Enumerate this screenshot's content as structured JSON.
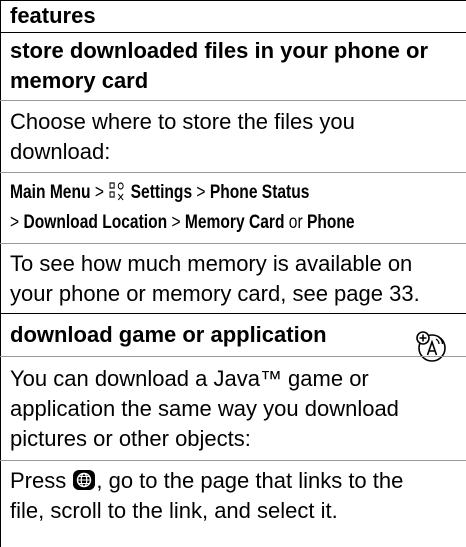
{
  "section": {
    "title": "features"
  },
  "store": {
    "heading_line1": "store downloaded files in your phone or",
    "heading_line2": "memory card",
    "intro_line1": "Choose where to store the files you",
    "intro_line2": "download:",
    "path_line1": {
      "main_menu": "Main Menu",
      "sep": ">",
      "settings_icon": "settings-icon",
      "settings": "Settings",
      "phone_status": "Phone Status"
    },
    "path_line2": {
      "sep": ">",
      "download_location": "Download Location",
      "memory_card": "Memory Card",
      "or": "or",
      "phone": "Phone"
    },
    "note_line1": "To see how much memory is available on",
    "note_line2": "your phone or memory card, see page 33."
  },
  "download": {
    "heading": "download game or application",
    "network_icon": "network-feature-icon",
    "body_line1": "You can download a Java™ game or",
    "body_line2": "application the same way you download",
    "body_line3": "pictures or other objects:",
    "press": "Press",
    "nav_key_icon": "browser-key-icon",
    "steps_line1_rest": ", go to the page that links to the",
    "steps_line2": "file, scroll to the link, and select it."
  }
}
